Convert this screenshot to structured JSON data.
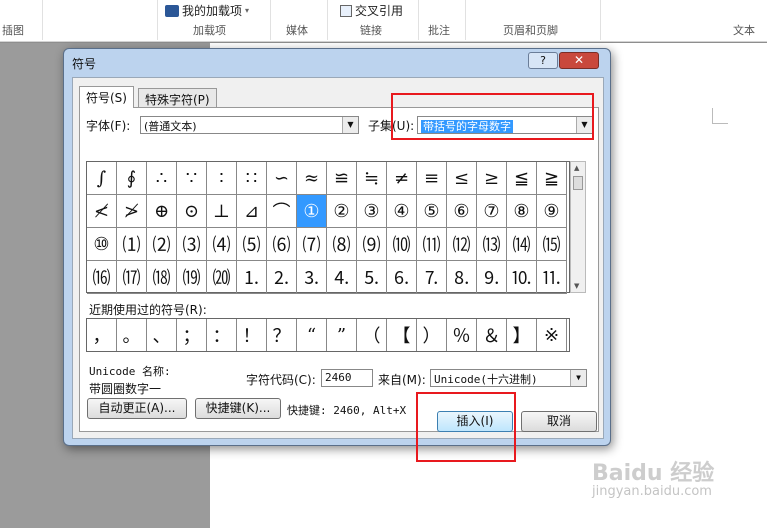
{
  "ribbon": {
    "group_labels": [
      "插图",
      "加载项",
      "媒体",
      "链接",
      "批注",
      "页眉和页脚",
      "文本"
    ],
    "my_addins": "我的加载项",
    "cross_ref": "交叉引用"
  },
  "dialog": {
    "title": "符号",
    "help": "?",
    "close": "✕",
    "tabs": [
      "符号(S)",
      "特殊字符(P)"
    ],
    "font_label": "字体(F):",
    "font_value": "(普通文本)",
    "subset_label": "子集(U):",
    "subset_value": "带括号的字母数字",
    "symbol_rows": [
      [
        "∫",
        "∮",
        "∴",
        "∵",
        "∶",
        "∷",
        "∽",
        "≈",
        "≌",
        "≒",
        "≠",
        "≡",
        "≤",
        "≥",
        "≦",
        "≧"
      ],
      [
        "≮",
        "≯",
        "⊕",
        "⊙",
        "⊥",
        "⊿",
        "⌒",
        "①",
        "②",
        "③",
        "④",
        "⑤",
        "⑥",
        "⑦",
        "⑧",
        "⑨"
      ],
      [
        "⑩",
        "⑴",
        "⑵",
        "⑶",
        "⑷",
        "⑸",
        "⑹",
        "⑺",
        "⑻",
        "⑼",
        "⑽",
        "⑾",
        "⑿",
        "⒀",
        "⒁",
        "⒂"
      ],
      [
        "⒃",
        "⒄",
        "⒅",
        "⒆",
        "⒇",
        "⒈",
        "⒉",
        "⒊",
        "⒋",
        "⒌",
        "⒍",
        "⒎",
        "⒏",
        "⒐",
        "⒑",
        "⒒"
      ]
    ],
    "selected_symbol": "①",
    "recent_label": "近期使用过的符号(R):",
    "recent_symbols": [
      "，",
      "。",
      "、",
      "；",
      "：",
      "！",
      "？",
      "“",
      "”",
      "（",
      "【",
      "）",
      "％",
      "＆",
      "】",
      "※"
    ],
    "unicode_name_label": "Unicode 名称:",
    "unicode_name_value": "带圆圈数字一",
    "char_code_label": "字符代码(C):",
    "char_code_value": "2460",
    "from_label": "来自(M):",
    "from_value": "Unicode(十六进制)",
    "autocorrect_btn": "自动更正(A)...",
    "shortcut_btn": "快捷键(K)...",
    "shortcut_text": "快捷键: 2460, Alt+X",
    "insert_btn": "插入(I)",
    "cancel_btn": "取消"
  },
  "watermark": {
    "brand": "Baidu 经验",
    "url": "jingyan.baidu.com"
  },
  "colors": {
    "selection": "#3399ff",
    "highlight": "#e8191e",
    "frame": "#bcd3ee",
    "close": "#c9483c"
  }
}
